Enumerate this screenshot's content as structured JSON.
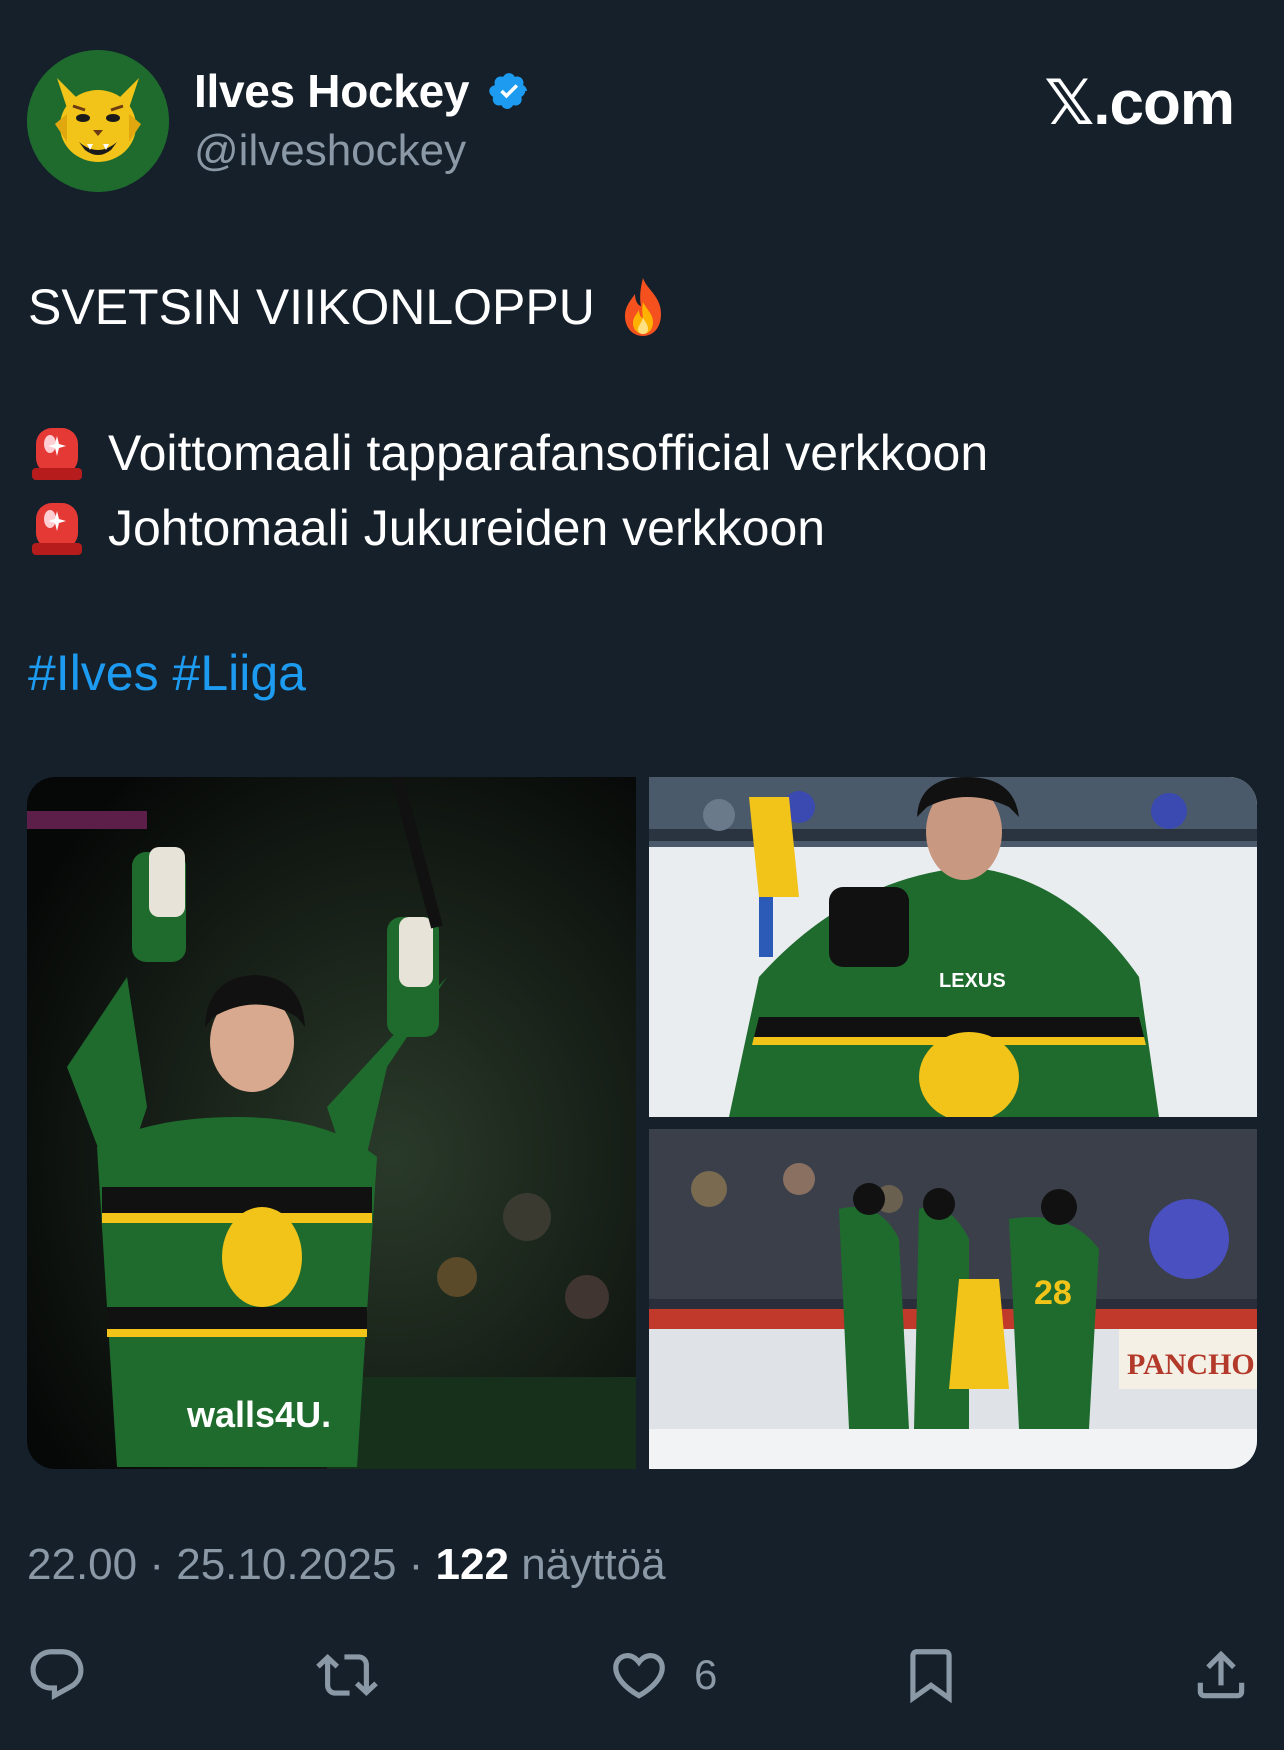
{
  "author": {
    "name": "Ilves Hockey",
    "handle": "@ilveshockey",
    "verified": true,
    "avatar_icon": "lynx-logo-icon",
    "verified_color": "#1d9bf0"
  },
  "brand": {
    "text": ".com",
    "icon": "x-logo-icon"
  },
  "tweet": {
    "title": "SVETSIN VIIKONLOPPU",
    "title_emoji": "fire-emoji-icon",
    "lines": [
      {
        "emoji": "siren-emoji-icon",
        "text": "Voittomaali tapparafansofficial verkkoon"
      },
      {
        "emoji": "siren-emoji-icon",
        "text": "Johtomaali Jukureiden verkkoon"
      }
    ],
    "hashtags": [
      "#Ilves",
      "#Liiga"
    ],
    "hashtag_color": "#1d9bf0"
  },
  "media": [
    {
      "kind": "photo",
      "name": "player-celebrating-arms-raised-photo"
    },
    {
      "kind": "photo",
      "name": "player-closeup-skating-photo"
    },
    {
      "kind": "photo",
      "name": "team-celebration-photo"
    }
  ],
  "meta": {
    "time": "22.00",
    "date": "25.10.2025",
    "views": "122",
    "views_label": "näyttöä"
  },
  "actions": {
    "reply_icon": "reply-icon",
    "retweet_icon": "retweet-icon",
    "like_icon": "heart-icon",
    "like_count": "6",
    "bookmark_icon": "bookmark-icon",
    "share_icon": "share-icon"
  },
  "colors": {
    "background": "#15202b",
    "text": "#ffffff",
    "muted": "#8b98a5",
    "team_green": "#1f6b2e",
    "team_yellow": "#f2c318"
  }
}
